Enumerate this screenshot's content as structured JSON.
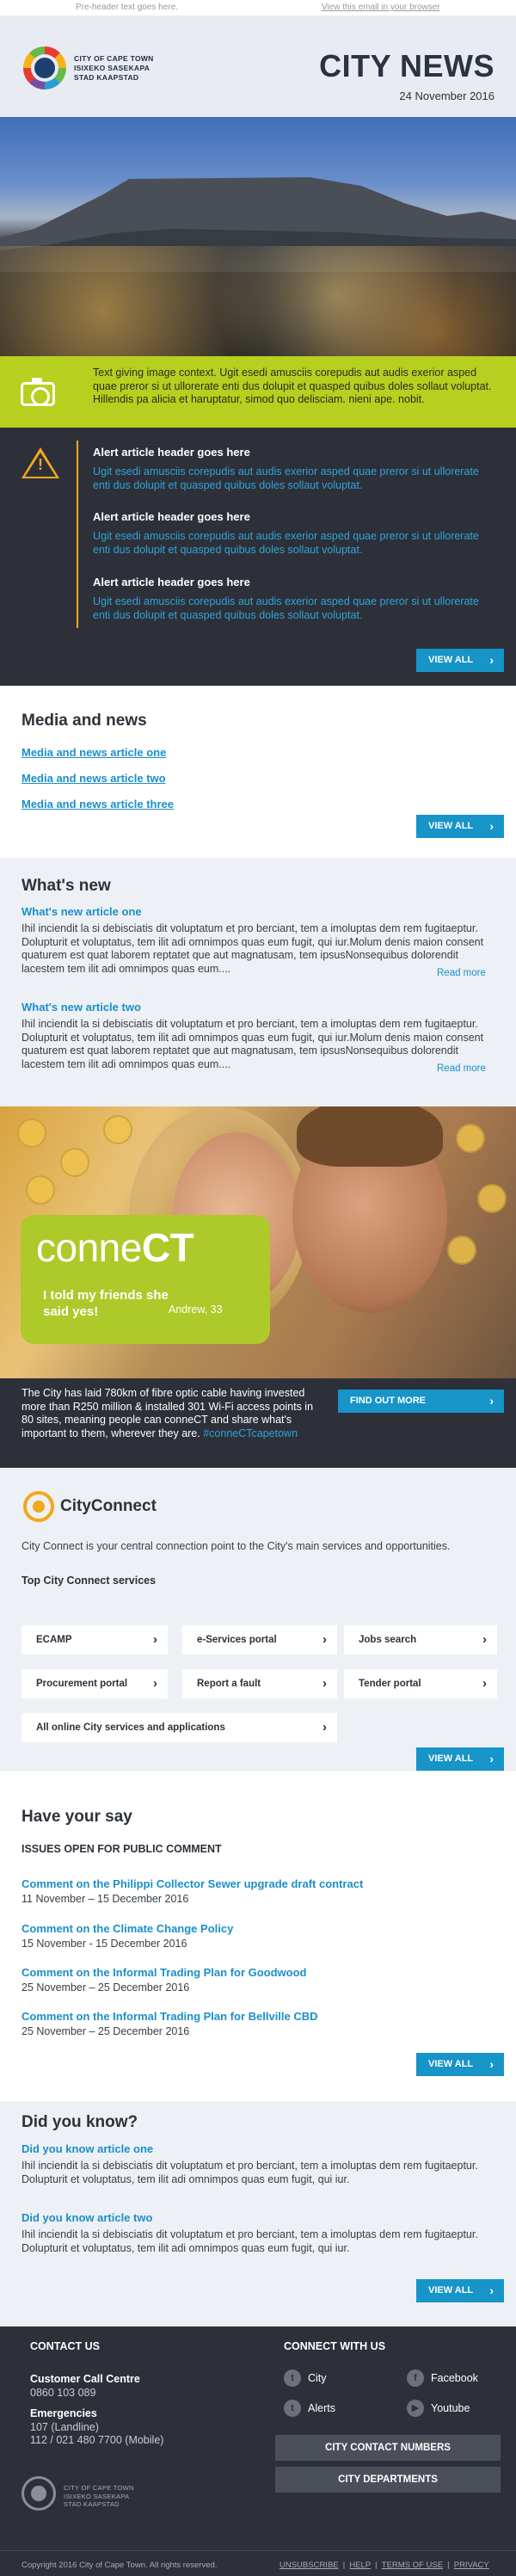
{
  "preheader": {
    "text": "Pre-header text goes here.",
    "view_link": "View this email in your browser"
  },
  "header": {
    "logo_lines": [
      "CITY OF CAPE TOWN",
      "ISIXEKO SASEKAPA",
      "STAD KAAPSTAD"
    ],
    "title": "CITY NEWS",
    "date": "24 November 2016"
  },
  "caption": {
    "text": "Text giving image context. Ugit esedi amusciis corepudis aut audis exerior asped quae preror si ut ullorerate enti dus dolupit et quasped quibus doles sollaut voluptat. Hillendis pa alicia et haruptatur, simod quo delisciam. nieni ape. nobit."
  },
  "alerts": {
    "items": [
      {
        "title": "Alert article header goes here",
        "body": "Ugit esedi amusciis corepudis aut audis exerior asped quae preror si ut ullorerate enti dus dolupit et quasped quibus doles sollaut voluptat."
      },
      {
        "title": "Alert article header goes here",
        "body": "Ugit esedi amusciis corepudis aut audis exerior asped quae preror si ut ullorerate enti dus dolupit et quasped quibus doles sollaut voluptat."
      },
      {
        "title": "Alert article header goes here",
        "body": "Ugit esedi amusciis corepudis aut audis exerior asped quae preror si ut ullorerate enti dus dolupit et quasped quibus doles sollaut voluptat."
      }
    ],
    "view_all": "VIEW ALL"
  },
  "media": {
    "title": "Media and news",
    "links": [
      "Media and news article one",
      "Media and news article two",
      "Media and news article three"
    ],
    "view_all": "VIEW ALL"
  },
  "whats_new": {
    "title": "What's new",
    "articles": [
      {
        "title": "What's new article one",
        "body": "Ihil inciendit la si debisciatis dit voluptatum et pro berciant, tem a imoluptas dem rem fugitaeptur. Dolupturit et voluptatus, tem ilit adi omnimpos quas eum fugit, qui iur.Molum denis maion consent quaturem est quat laborem reptatet que aut magnatusam, tem ipsusNonsequibus dolorendit lacestem tem ilit adi omnimpos quas eum....",
        "read_more": "Read more"
      },
      {
        "title": "What's new article two",
        "body": "Ihil inciendit la si debisciatis dit voluptatum et pro berciant, tem a imoluptas dem rem fugitaeptur. Dolupturit et voluptatus, tem ilit adi omnimpos quas eum fugit, qui iur.Molum denis maion consent quaturem est quat laborem reptatet que aut magnatusam, tem ipsusNonsequibus dolorendit lacestem tem ilit adi omnimpos quas eum....",
        "read_more": "Read more"
      }
    ]
  },
  "promo": {
    "logo_light": "conne",
    "logo_bold": "CT",
    "quote": "I told my friends she said yes!",
    "name": "Andrew, 33",
    "text": "The City has laid 780km of fibre optic cable having invested more than R250 million & installed 301 Wi-Fi access points in 80 sites, meaning people can conneCT and share what's important to them, wherever they are.",
    "hashtag": "#conneCTcapetown",
    "button": "FIND OUT MORE"
  },
  "city_connect": {
    "title": "CityConnect",
    "description": "City Connect is your central connection point to the City's main services and opportunities.",
    "subtitle": "Top City Connect services",
    "services": [
      "ECAMP",
      "e-Services portal",
      "Jobs search",
      "Procurement portal",
      "Report a fault",
      "Tender portal"
    ],
    "all_services": "All online City services and applications",
    "view_all": "VIEW ALL"
  },
  "have_your_say": {
    "title": "Have your say",
    "subtitle": "ISSUES OPEN FOR PUBLIC COMMENT",
    "items": [
      {
        "title": "Comment on the Philippi Collector Sewer upgrade draft contract",
        "dates": "11 November – 15 December 2016"
      },
      {
        "title": "Comment on the Climate Change Policy",
        "dates": "15 November - 15 December 2016"
      },
      {
        "title": "Comment on the Informal Trading Plan for Goodwood",
        "dates": "25 November – 25 December 2016"
      },
      {
        "title": "Comment on the Informal Trading Plan for Bellville CBD",
        "dates": "25 November – 25 December 2016"
      }
    ],
    "view_all": "VIEW ALL"
  },
  "did_you_know": {
    "title": "Did you know?",
    "articles": [
      {
        "title": "Did you know article one",
        "body": "Ihil inciendit la si debisciatis dit voluptatum et pro berciant, tem a imoluptas dem rem fugitaeptur. Dolupturit et voluptatus, tem ilit adi omnimpos quas eum fugit, qui iur."
      },
      {
        "title": "Did you know article two",
        "body": "Ihil inciendit la si debisciatis dit voluptatum et pro berciant, tem a imoluptas dem rem fugitaeptur. Dolupturit et voluptatus, tem ilit adi omnimpos quas eum fugit, qui iur."
      }
    ],
    "view_all": "VIEW ALL"
  },
  "footer": {
    "contact_title": "CONTACT US",
    "call_centre_label": "Customer Call Centre",
    "call_centre_number": "0860 103 089",
    "emergencies_label": "Emergencies",
    "emergencies_landline": "107 (Landline)",
    "emergencies_mobile": "112 / 021 480 7700 (Mobile)",
    "connect_title": "CONNECT WITH US",
    "social": [
      {
        "label": "City",
        "icon": "twitter-icon"
      },
      {
        "label": "Facebook",
        "icon": "facebook-icon"
      },
      {
        "label": "Alerts",
        "icon": "twitter-icon"
      },
      {
        "label": "Youtube",
        "icon": "youtube-icon"
      }
    ],
    "contact_numbers_button": "CITY CONTACT NUMBERS",
    "departments_button": "CITY DEPARTMENTS",
    "logo_lines": [
      "CITY OF CAPE TOWN",
      "ISIXEKO SASEKAPA",
      "STAD KAAPSTAD"
    ],
    "copyright": "Copyright 2016 City of Cape Town. All rights reserved.",
    "links": [
      "UNSUBSCRIBE",
      "HELP",
      "TERMS OF USE",
      "PRIVACY"
    ]
  },
  "colors": {
    "accent_blue": "#1794c8",
    "lime": "#b7cf1e",
    "dark": "#2d3039",
    "warning": "#f2a81d"
  }
}
